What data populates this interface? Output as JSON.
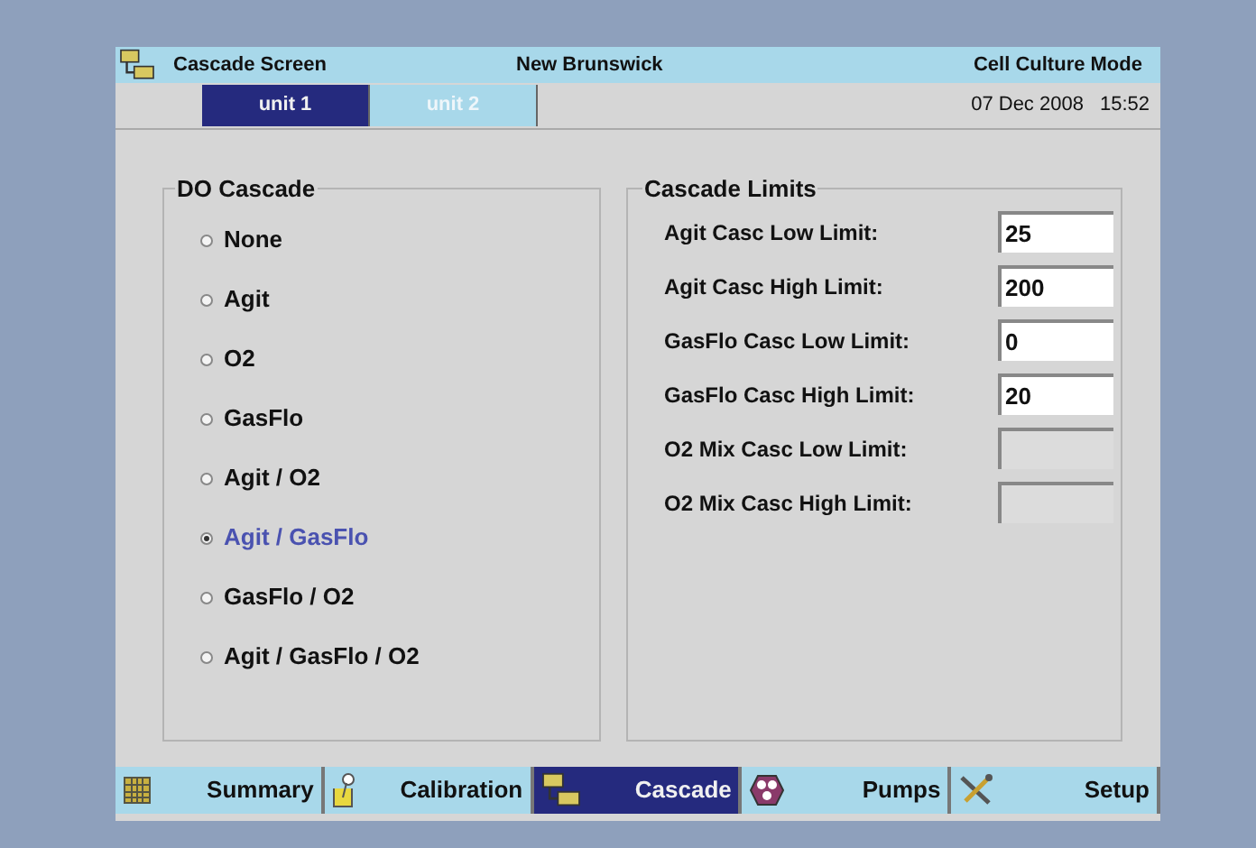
{
  "window": {
    "title": "Cascade Screen",
    "center": "New Brunswick",
    "mode": "Cell Culture Mode"
  },
  "units": [
    {
      "label": "unit 1",
      "selected": true
    },
    {
      "label": "unit 2",
      "selected": false
    }
  ],
  "datetime": {
    "date": "07 Dec 2008",
    "time": "15:52"
  },
  "do_cascade": {
    "title": "DO Cascade",
    "options": [
      {
        "label": "None",
        "selected": false
      },
      {
        "label": "Agit",
        "selected": false
      },
      {
        "label": "O2",
        "selected": false
      },
      {
        "label": "GasFlo",
        "selected": false
      },
      {
        "label": "Agit / O2",
        "selected": false
      },
      {
        "label": "Agit / GasFlo",
        "selected": true
      },
      {
        "label": "GasFlo / O2",
        "selected": false
      },
      {
        "label": "Agit / GasFlo / O2",
        "selected": false
      }
    ]
  },
  "cascade_limits": {
    "title": "Cascade Limits",
    "fields": [
      {
        "label": "Agit Casc Low Limit:",
        "value": "25",
        "disabled": false
      },
      {
        "label": "Agit Casc High Limit:",
        "value": "200",
        "disabled": false
      },
      {
        "label": "GasFlo Casc Low Limit:",
        "value": "0",
        "disabled": false
      },
      {
        "label": "GasFlo Casc High Limit:",
        "value": "20",
        "disabled": false
      },
      {
        "label": "O2 Mix Casc Low Limit:",
        "disabled": true
      },
      {
        "label": "O2 Mix Casc High Limit:",
        "disabled": true
      }
    ]
  },
  "nav": [
    {
      "label": "Summary",
      "kind": "grid",
      "selected": false
    },
    {
      "label": "Calibration",
      "kind": "beaker",
      "selected": false
    },
    {
      "label": "Cascade",
      "kind": "cascade",
      "selected": true
    },
    {
      "label": "Pumps",
      "kind": "pump",
      "selected": false
    },
    {
      "label": "Setup",
      "kind": "tools",
      "selected": false
    }
  ]
}
